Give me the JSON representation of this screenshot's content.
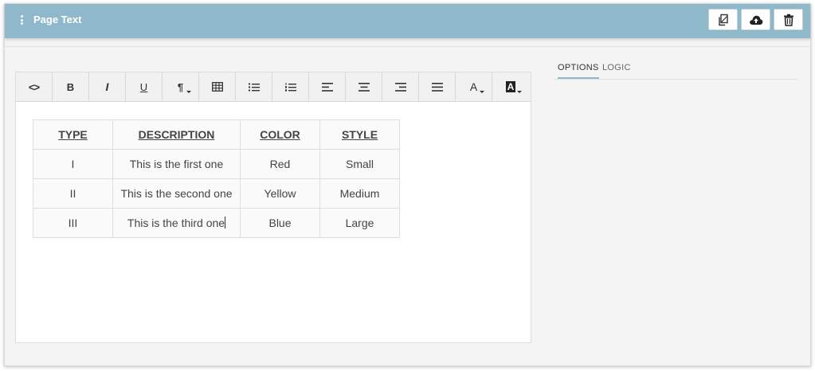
{
  "header": {
    "title": "Page Text",
    "buttons": [
      {
        "icon": "copy-icon"
      },
      {
        "icon": "cloud-upload-icon"
      },
      {
        "icon": "trash-icon"
      }
    ]
  },
  "toolbar": {
    "items": [
      {
        "icon": "code-icon",
        "glyph": "<>"
      },
      {
        "icon": "bold-icon",
        "glyph": "B"
      },
      {
        "icon": "italic-icon",
        "glyph": "I"
      },
      {
        "icon": "underline-icon",
        "glyph": "U"
      },
      {
        "icon": "paragraph-icon",
        "glyph": "¶"
      },
      {
        "icon": "table-icon",
        "glyph": ""
      },
      {
        "icon": "bullet-list-icon",
        "glyph": ""
      },
      {
        "icon": "numbered-list-icon",
        "glyph": ""
      },
      {
        "icon": "align-left-icon",
        "glyph": ""
      },
      {
        "icon": "align-center-icon",
        "glyph": ""
      },
      {
        "icon": "align-right-icon",
        "glyph": ""
      },
      {
        "icon": "align-justify-icon",
        "glyph": ""
      },
      {
        "icon": "font-color-icon",
        "glyph": "A"
      },
      {
        "icon": "highlight-color-icon",
        "glyph": "A"
      }
    ]
  },
  "table": {
    "headers": [
      "TYPE",
      "DESCRIPTION",
      "COLOR",
      "STYLE"
    ],
    "rows": [
      [
        "I",
        "This is the first one",
        "Red",
        "Small"
      ],
      [
        "II",
        "This is the second one",
        "Yellow",
        "Medium"
      ],
      [
        "III",
        "This is the third one",
        "Blue",
        "Large"
      ]
    ]
  },
  "tabs": {
    "options_label": "OPTIONS",
    "logic_label": "LOGIC"
  },
  "colors": {
    "header_bg": "#8fb9cb",
    "panel_bg": "#f4f4f4",
    "active_tab_underline": "#8fb9cb"
  }
}
